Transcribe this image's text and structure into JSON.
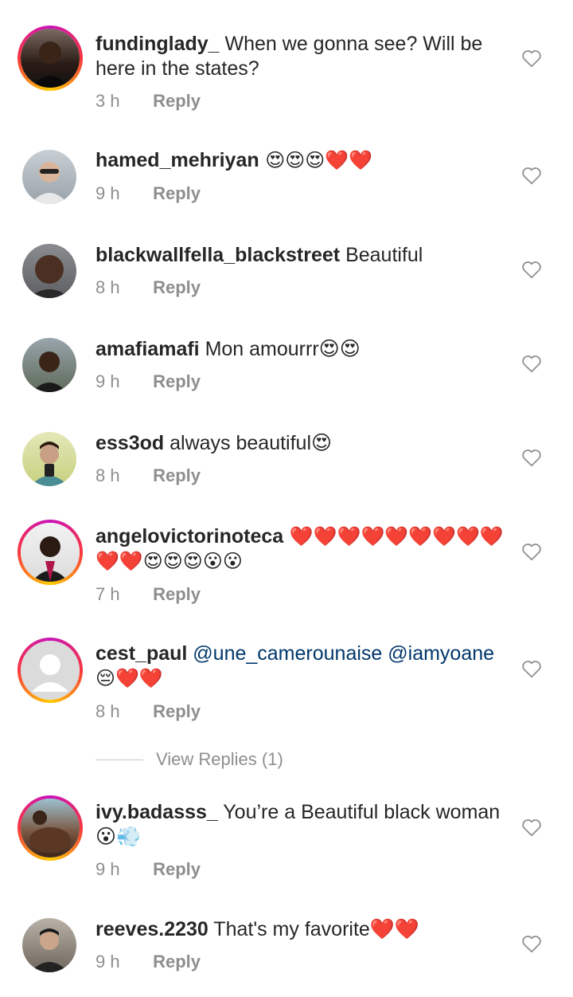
{
  "comments": [
    {
      "user": "fundinglady_",
      "text": " When we gonna see? Will be here in the states?",
      "time": "3 h",
      "reply": "Reply"
    },
    {
      "user": "hamed_mehriyan",
      "text": " 😍😍😍❤️❤️",
      "time": "9 h",
      "reply": "Reply"
    },
    {
      "user": "blackwallfella_blackstreet",
      "text": " Beautiful",
      "time": "8 h",
      "reply": "Reply"
    },
    {
      "user": "amafiamafi",
      "text": " Mon amourrr😍😍",
      "time": "9 h",
      "reply": "Reply"
    },
    {
      "user": "ess3od",
      "text": " always beautiful😍",
      "time": "8 h",
      "reply": "Reply"
    },
    {
      "user": "angelovictorinoteca",
      "text": " ❤️❤️❤️❤️❤️❤️❤️❤️❤️❤️❤️😍😍😍😮😮",
      "time": "7 h",
      "reply": "Reply"
    },
    {
      "user": "cest_paul",
      "mention1": " @une_camerounaise",
      "mention2": " @iamyoane",
      "text": " 😔❤️❤️",
      "time": "8 h",
      "reply": "Reply"
    },
    {
      "user": "ivy.badasss_",
      "text": " You’re a Beautiful black woman 😮💨",
      "time": "9 h",
      "reply": "Reply"
    },
    {
      "user": "reeves.2230",
      "text": " That's my favorite❤️❤️",
      "time": "9 h",
      "reply": "Reply"
    }
  ],
  "view_replies": "View Replies (1)",
  "icons": {
    "like": "heart-outline-icon"
  },
  "colors": {
    "text": "#262626",
    "secondary": "#8e8e8e",
    "mention": "#00376b"
  }
}
